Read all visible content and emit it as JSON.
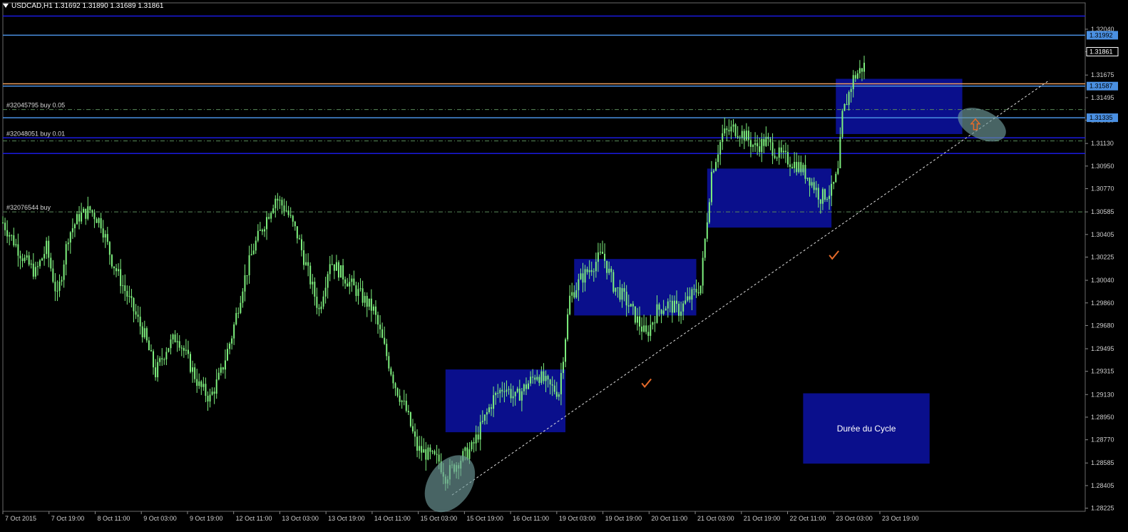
{
  "chart_data": {
    "type": "line",
    "symbol_label": "USDCAD,H1  1.31692 1.31890 1.31689 1.31861",
    "price_axis": {
      "ticks": [
        "1.32040",
        "1.31861",
        "1.31675",
        "1.31495",
        "1.31315",
        "1.31130",
        "1.30950",
        "1.30770",
        "1.30585",
        "1.30405",
        "1.30225",
        "1.30040",
        "1.29860",
        "1.29680",
        "1.29495",
        "1.29315",
        "1.29130",
        "1.28950",
        "1.28770",
        "1.28585",
        "1.28405",
        "1.28225"
      ],
      "ylim": [
        1.282,
        1.3225
      ],
      "boxed_labels": [
        {
          "price": 1.31992,
          "text": "1.31992",
          "color": "#4a90e2"
        },
        {
          "price": 1.31861,
          "text": "1.31861",
          "color": "#ffffff"
        },
        {
          "price": 1.31587,
          "text": "1.31587",
          "color": "#4a90e2"
        },
        {
          "price": 1.31335,
          "text": "1.31335",
          "color": "#4a90e2"
        }
      ]
    },
    "time_axis": {
      "labels": [
        "7 Oct 2015",
        "7 Oct 19:00",
        "8 Oct 11:00",
        "9 Oct 03:00",
        "9 Oct 19:00",
        "12 Oct 11:00",
        "13 Oct 03:00",
        "13 Oct 19:00",
        "14 Oct 11:00",
        "15 Oct 03:00",
        "15 Oct 19:00",
        "16 Oct 11:00",
        "19 Oct 03:00",
        "19 Oct 19:00",
        "20 Oct 11:00",
        "21 Oct 03:00",
        "21 Oct 19:00",
        "22 Oct 11:00",
        "23 Oct 03:00",
        "23 Oct 19:00"
      ]
    },
    "price_path": [
      [
        0,
        1.305
      ],
      [
        5,
        1.3035
      ],
      [
        10,
        1.302
      ],
      [
        15,
        1.301
      ],
      [
        20,
        1.303
      ],
      [
        25,
        1.299
      ],
      [
        30,
        1.304
      ],
      [
        35,
        1.3055
      ],
      [
        40,
        1.306
      ],
      [
        45,
        1.305
      ],
      [
        50,
        1.302
      ],
      [
        55,
        1.3
      ],
      [
        60,
        1.298
      ],
      [
        65,
        1.296
      ],
      [
        70,
        1.293
      ],
      [
        75,
        1.295
      ],
      [
        80,
        1.296
      ],
      [
        85,
        1.294
      ],
      [
        90,
        1.292
      ],
      [
        95,
        1.291
      ],
      [
        100,
        1.293
      ],
      [
        105,
        1.296
      ],
      [
        110,
        1.3
      ],
      [
        115,
        1.303
      ],
      [
        120,
        1.305
      ],
      [
        125,
        1.307
      ],
      [
        130,
        1.306
      ],
      [
        135,
        1.304
      ],
      [
        140,
        1.301
      ],
      [
        145,
        1.298
      ],
      [
        150,
        1.302
      ],
      [
        155,
        1.301
      ],
      [
        160,
        1.3
      ],
      [
        165,
        1.299
      ],
      [
        170,
        1.298
      ],
      [
        175,
        1.295
      ],
      [
        180,
        1.292
      ],
      [
        185,
        1.29
      ],
      [
        190,
        1.287
      ],
      [
        195,
        1.2865
      ],
      [
        200,
        1.286
      ],
      [
        203,
        1.2848
      ],
      [
        210,
        1.2862
      ],
      [
        215,
        1.287
      ],
      [
        220,
        1.289
      ],
      [
        225,
        1.291
      ],
      [
        230,
        1.292
      ],
      [
        235,
        1.291
      ],
      [
        240,
        1.292
      ],
      [
        245,
        1.293
      ],
      [
        250,
        1.292
      ],
      [
        255,
        1.2915
      ],
      [
        260,
        1.299
      ],
      [
        265,
        1.3005
      ],
      [
        270,
        1.3015
      ],
      [
        275,
        1.3025
      ],
      [
        280,
        1.3
      ],
      [
        285,
        1.299
      ],
      [
        290,
        1.2975
      ],
      [
        295,
        1.296
      ],
      [
        300,
        1.298
      ],
      [
        305,
        1.2985
      ],
      [
        310,
        1.298
      ],
      [
        315,
        1.299
      ],
      [
        320,
        1.3
      ],
      [
        325,
        1.309
      ],
      [
        330,
        1.312
      ],
      [
        335,
        1.3125
      ],
      [
        340,
        1.312
      ],
      [
        345,
        1.311
      ],
      [
        350,
        1.3115
      ],
      [
        355,
        1.3105
      ],
      [
        360,
        1.31
      ],
      [
        365,
        1.3095
      ],
      [
        370,
        1.3085
      ],
      [
        375,
        1.307
      ],
      [
        380,
        1.3075
      ],
      [
        383,
        1.309
      ],
      [
        385,
        1.3135
      ],
      [
        390,
        1.3165
      ],
      [
        395,
        1.3175
      ]
    ],
    "price_path_bars": 395,
    "horizontal_lines": [
      {
        "price": 1.32145,
        "color": "#1a1ae0",
        "style": "solid"
      },
      {
        "price": 1.31992,
        "color": "#4a90e2",
        "style": "solid"
      },
      {
        "price": 1.31605,
        "color": "#f0a060",
        "style": "solid"
      },
      {
        "price": 1.31587,
        "color": "#4a90e2",
        "style": "solid"
      },
      {
        "price": 1.314,
        "color": "#5a8a5a",
        "style": "dashed"
      },
      {
        "price": 1.31335,
        "color": "#4a90e2",
        "style": "solid"
      },
      {
        "price": 1.31175,
        "color": "#1a1ae0",
        "style": "solid"
      },
      {
        "price": 1.3115,
        "color": "#5a8a5a",
        "style": "dashed"
      },
      {
        "price": 1.3105,
        "color": "#1a1ae0",
        "style": "solid"
      },
      {
        "price": 1.30585,
        "color": "#5a8a5a",
        "style": "dashed"
      }
    ],
    "order_labels": [
      {
        "price": 1.314,
        "text": "#32045795 buy 0.05"
      },
      {
        "price": 1.31175,
        "text": "#32048051 buy 0.01"
      },
      {
        "price": 1.30585,
        "text": "#32076544 buy"
      }
    ],
    "zones": [
      {
        "bar_from": 203,
        "bar_to": 258,
        "price_top": 1.2933,
        "price_bottom": 1.2883
      },
      {
        "bar_from": 262,
        "bar_to": 318,
        "price_top": 1.3021,
        "price_bottom": 1.2976
      },
      {
        "bar_from": 323,
        "bar_to": 380,
        "price_top": 1.3093,
        "price_bottom": 1.3046
      },
      {
        "bar_from": 382,
        "bar_to": 440,
        "price_top": 1.31645,
        "price_bottom": 1.31205
      }
    ],
    "trendline": {
      "from": [
        206,
        1.2833
      ],
      "to": [
        480,
        1.31635
      ]
    },
    "ellipses": [
      {
        "bar": 205,
        "price": 1.2842
      },
      {
        "bar": 449,
        "price": 1.3128
      }
    ],
    "checkmarks": [
      {
        "bar": 295,
        "price": 1.2922
      },
      {
        "bar": 381,
        "price": 1.3024
      }
    ],
    "arrow_up": {
      "bar": 446,
      "price": 1.3128
    },
    "cycle_box": {
      "bar_from": 367,
      "bar_to": 425,
      "price_top": 1.2914,
      "price_bottom": 1.2858,
      "label": "Durée du Cycle"
    },
    "colors": {
      "background": "#000000",
      "candle": "#7ef07e",
      "zone_fill": "#0a0f8c",
      "ellipse_fill": "#6f9a9a",
      "checkmark": "#e46a2a",
      "arrow": "#e46a2a",
      "axis_text": "#cfcfcf",
      "trendline": "#e0e0e0"
    }
  }
}
